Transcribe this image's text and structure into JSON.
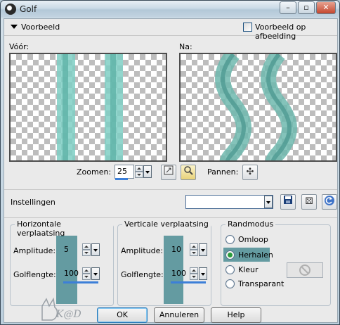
{
  "window": {
    "title": "Golf",
    "controls": {
      "minimize": "–",
      "maximize": "▫",
      "close": "✕"
    }
  },
  "preview": {
    "toggle_label": "Voorbeeld",
    "on_image_label": "Voorbeeld op afbeelding",
    "on_image_checked": false,
    "before_label": "Vóór:",
    "after_label": "Na:"
  },
  "zoom": {
    "label": "Zoomen:",
    "value": "25",
    "pan_label": "Pannen:"
  },
  "settings": {
    "label": "Instellingen",
    "value": ""
  },
  "horizontal": {
    "title": "Horizontale verplaatsing",
    "amplitude_label": "Amplitude:",
    "amplitude": "5",
    "wavelength_label": "Golflengte:",
    "wavelength": "100"
  },
  "vertical": {
    "title": "Verticale verplaatsing",
    "amplitude_label": "Amplitude:",
    "amplitude": "10",
    "wavelength_label": "Golflengte:",
    "wavelength": "100"
  },
  "edge_mode": {
    "title": "Randmodus",
    "options": [
      "Omloop",
      "Herhalen",
      "Kleur",
      "Transparant"
    ],
    "selected": "Herhalen"
  },
  "buttons": {
    "ok": "OK",
    "cancel": "Annuleren",
    "help": "Help"
  },
  "logo_text": "K@D",
  "colors": {
    "accent": "#3c7fd8",
    "stripe": "#7fcfc4",
    "highlight": "#4c8d94"
  },
  "icons": [
    "app-icon",
    "eye-icon",
    "move-icon",
    "save-icon",
    "dice-icon",
    "reset-icon",
    "no-color-icon"
  ]
}
